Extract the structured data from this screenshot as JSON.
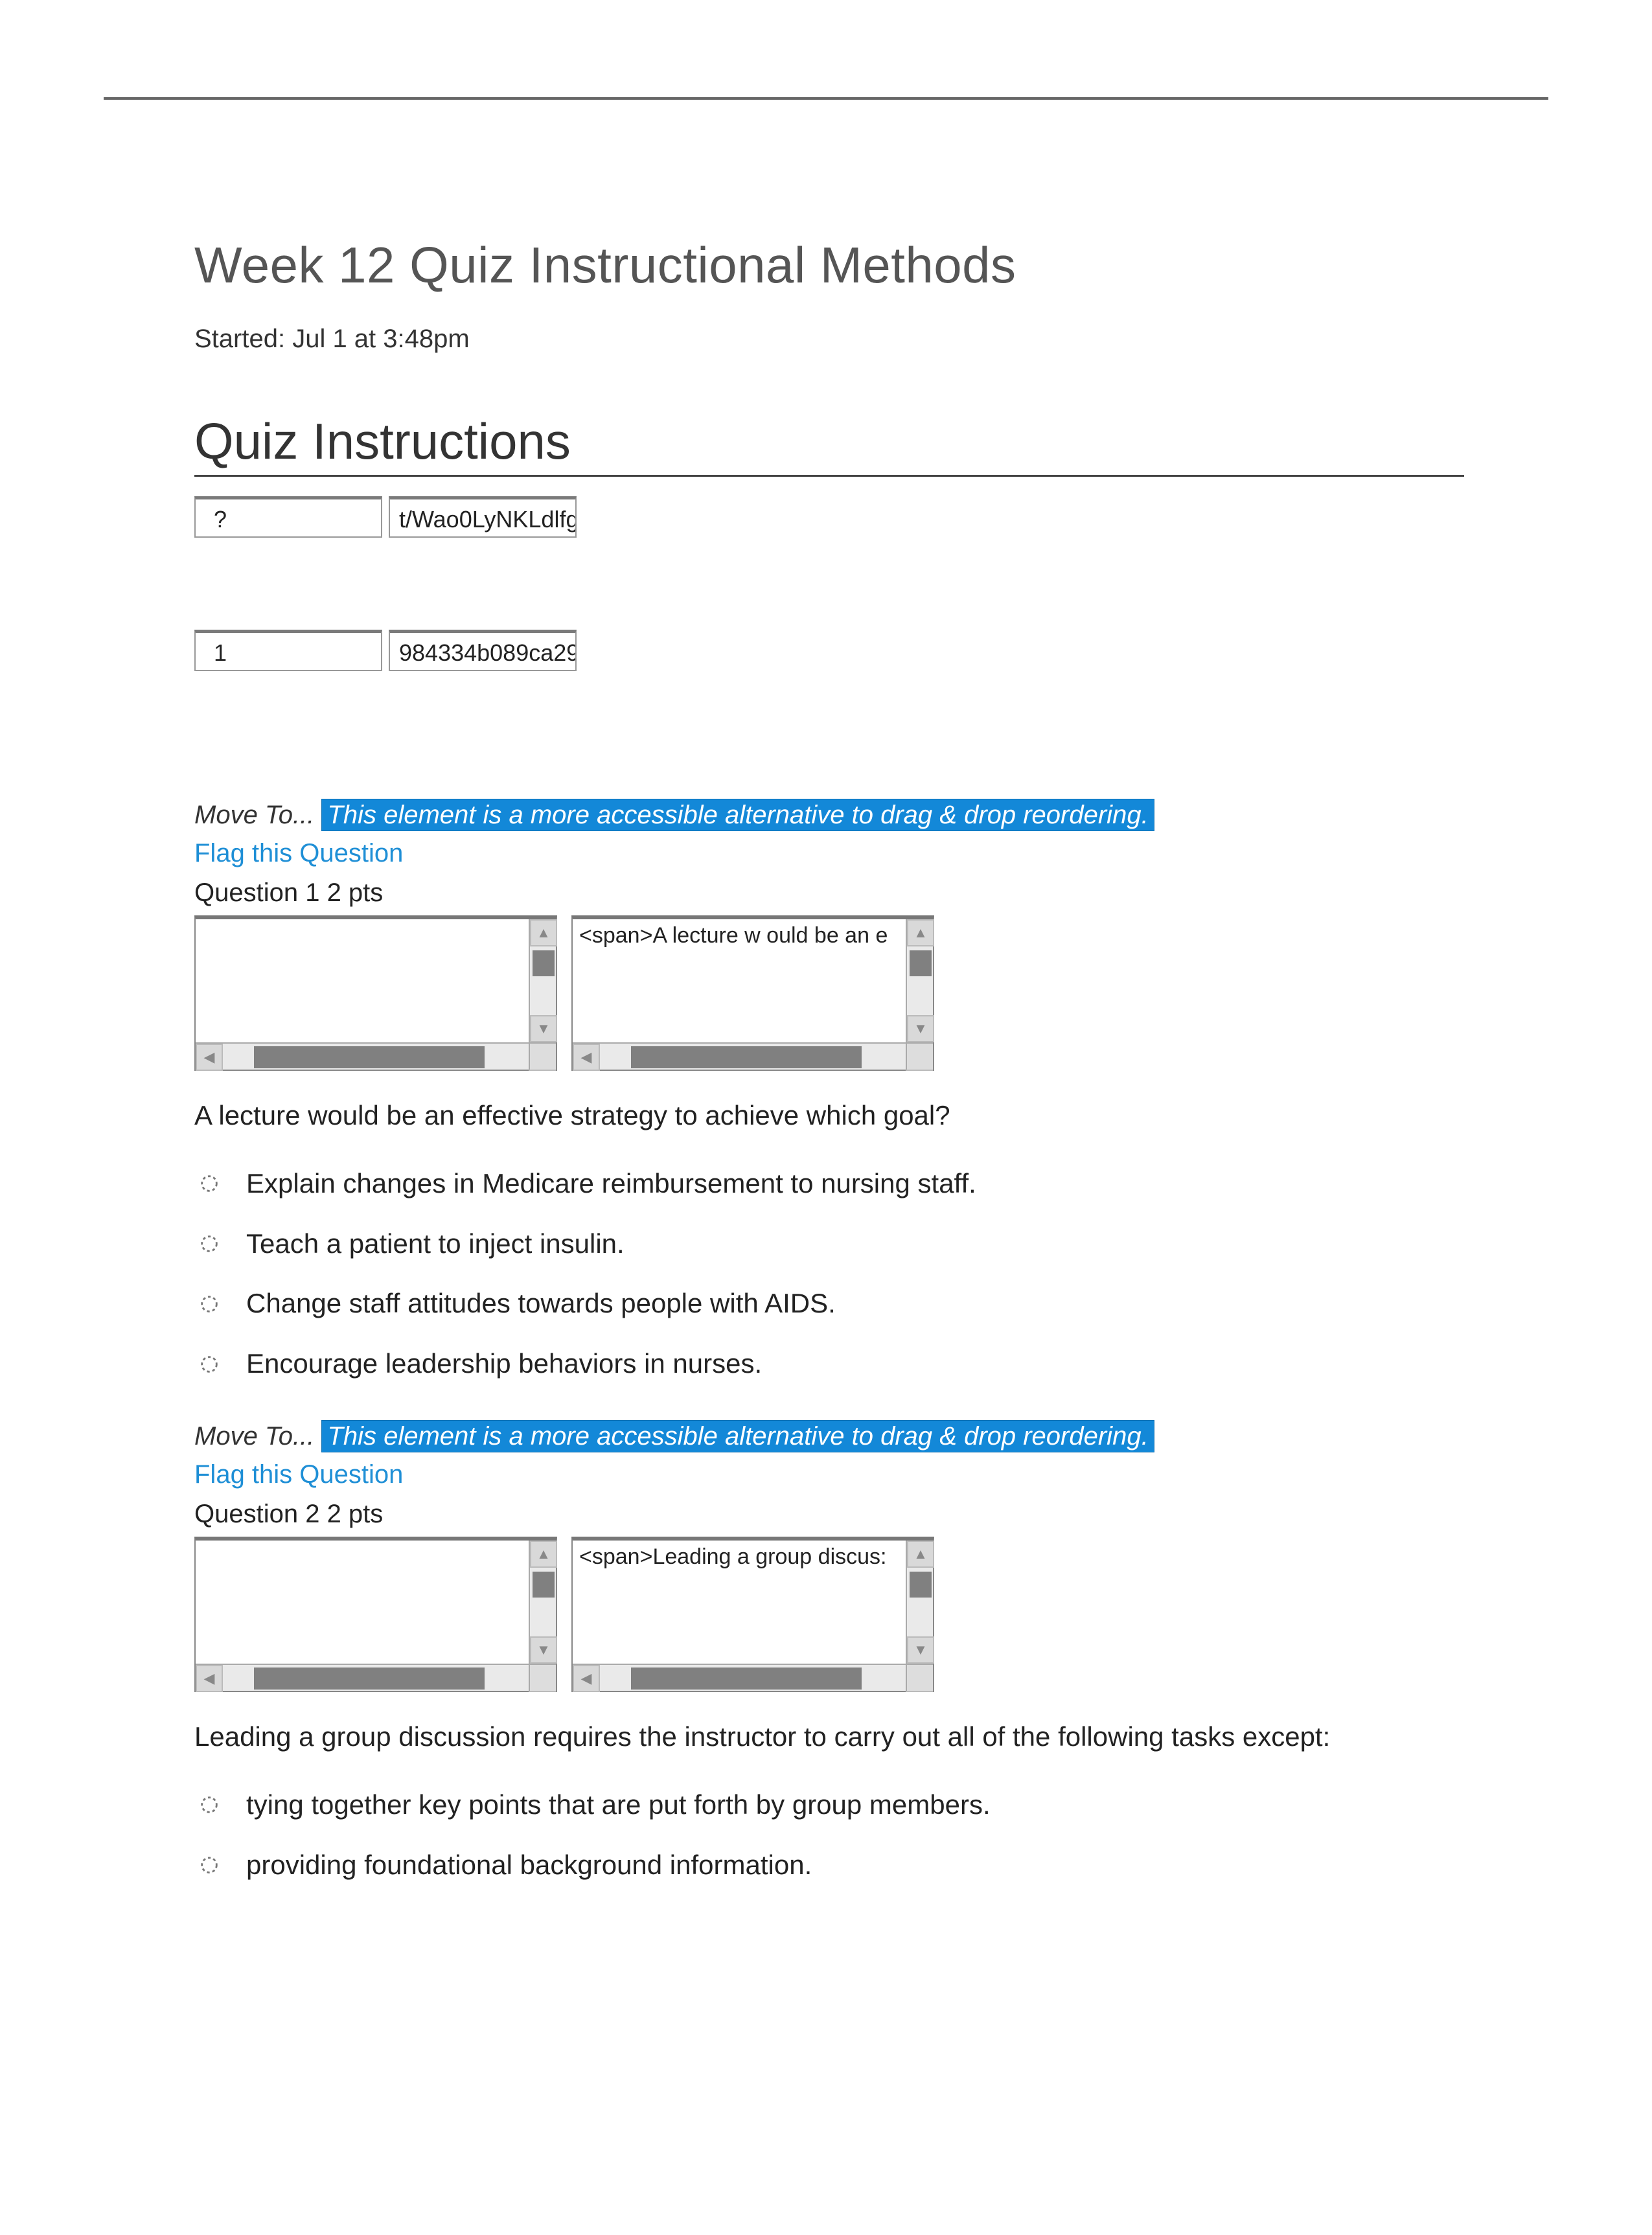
{
  "page_title": "Week 12 Quiz Instructional Methods",
  "started_line": "Started: Jul 1 at 3:48pm",
  "instructions_heading": "Quiz Instructions",
  "row_a": {
    "left": "?",
    "right": "t/Wao0LyNKLdlfg"
  },
  "row_b": {
    "left": "1",
    "right": "984334b089ca29"
  },
  "shared": {
    "move_label": "Move To... ",
    "move_hl": "This element is a more accessible alternative to drag & drop reordering.",
    "flag_text": "Flag this Question"
  },
  "q1": {
    "header": "Question 1 2 pts",
    "editor_right_snippet": "<span>A lecture w ould be an e",
    "prompt": "A lecture would be an effective strategy to achieve which goal?",
    "options": [
      "Explain changes in Medicare reimbursement to nursing staff.",
      "Teach a patient to inject insulin.",
      "Change staff attitudes towards people with AIDS.",
      "Encourage leadership behaviors in nurses."
    ]
  },
  "q2": {
    "header": "Question 2 2 pts",
    "editor_right_snippet": "<span>Leading a group discus:",
    "prompt": "Leading a group discussion requires the instructor to carry out all of the following tasks except:",
    "options": [
      "tying together key points that are put forth by group members.",
      "providing foundational background information."
    ]
  }
}
